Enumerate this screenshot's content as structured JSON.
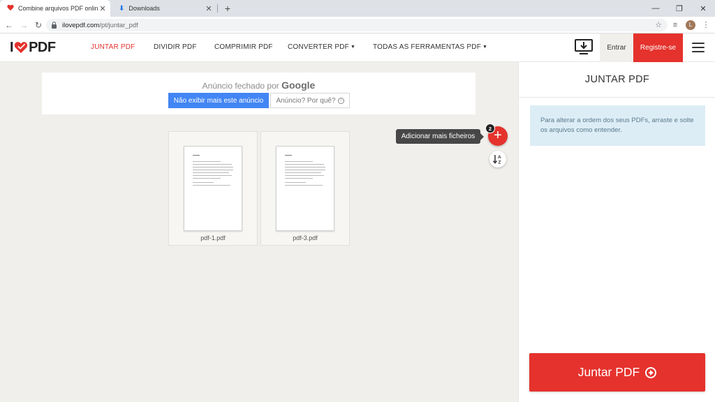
{
  "browser": {
    "tabs": [
      {
        "title": "Combine arquivos PDF online. O",
        "close": "✕"
      },
      {
        "title": "Downloads",
        "close": "✕"
      }
    ],
    "new_tab": "+",
    "window_controls": {
      "minimize": "—",
      "restore": "❐",
      "close": "✕"
    },
    "nav": {
      "back": "←",
      "forward": "→",
      "reload": "↻"
    },
    "url": {
      "host": "ilovepdf.com",
      "path": "/pt/juntar_pdf"
    },
    "toolbar_icons": {
      "bookmark": "☆",
      "media": "≡",
      "menu": "⋮"
    },
    "profile_initial": "L"
  },
  "header": {
    "logo": {
      "prefix": "I",
      "suffix": "PDF"
    },
    "nav": [
      {
        "label": "JUNTAR PDF",
        "active": true
      },
      {
        "label": "DIVIDIR PDF"
      },
      {
        "label": "COMPRIMIR PDF"
      },
      {
        "label": "CONVERTER PDF",
        "caret": "▼"
      },
      {
        "label": "TODAS AS FERRAMENTAS PDF",
        "caret": "▼"
      }
    ],
    "login": "Entrar",
    "signup": "Registre-se"
  },
  "ad": {
    "closed_text": "Anúncio fechado por",
    "brand": "Google",
    "hide_button": "Não exibir mais este anúncio",
    "why_button": "Anúncio? Por quê?",
    "info_glyph": "i"
  },
  "files": [
    {
      "name": "pdf-1.pdf"
    },
    {
      "name": "pdf-3.pdf"
    }
  ],
  "controls": {
    "tooltip": "Adicionar mais ficheiros",
    "add_glyph": "+",
    "file_count": "2"
  },
  "sidebar": {
    "title": "JUNTAR PDF",
    "info": "Para alterar a ordem dos seus PDFs, arraste e solte os arquivos como entender.",
    "merge_button": "Juntar PDF"
  },
  "colors": {
    "brand_red": "#e5322d",
    "google_blue": "#4285f4",
    "info_bg": "#dcedf6"
  }
}
